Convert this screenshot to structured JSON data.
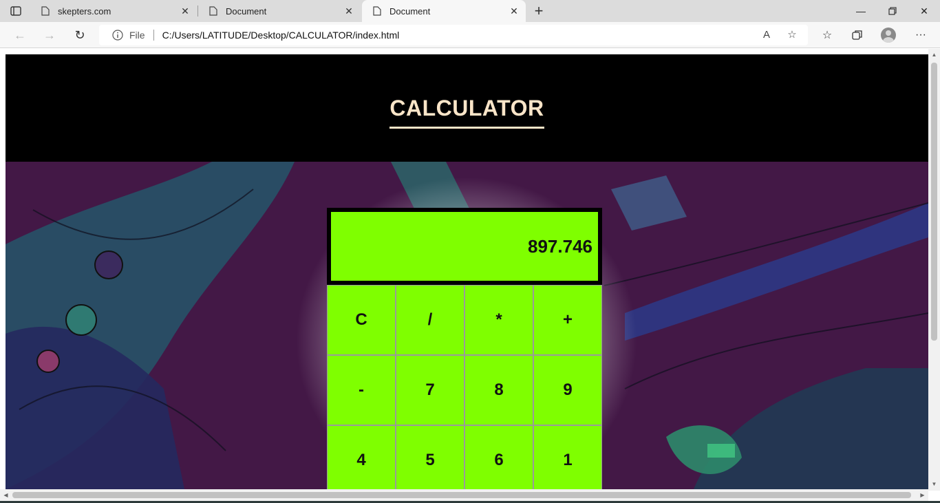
{
  "browser": {
    "tabs": [
      {
        "label": "skepters.com",
        "active": false
      },
      {
        "label": "Document",
        "active": false
      },
      {
        "label": "Document",
        "active": true
      }
    ],
    "omnibox": {
      "scheme_label": "File",
      "url": "C:/Users/LATITUDE/Desktop/CALCULATOR/index.html"
    }
  },
  "page": {
    "title": "CALCULATOR",
    "display_value": "897.746",
    "keys": [
      "C",
      "/",
      "*",
      "+",
      "-",
      "7",
      "8",
      "9",
      "4",
      "5",
      "6",
      "1"
    ],
    "colors": {
      "header_bg": "#000000",
      "title": "#fae5c8",
      "calc_green": "#7fff00",
      "background": "#3a1640"
    }
  }
}
